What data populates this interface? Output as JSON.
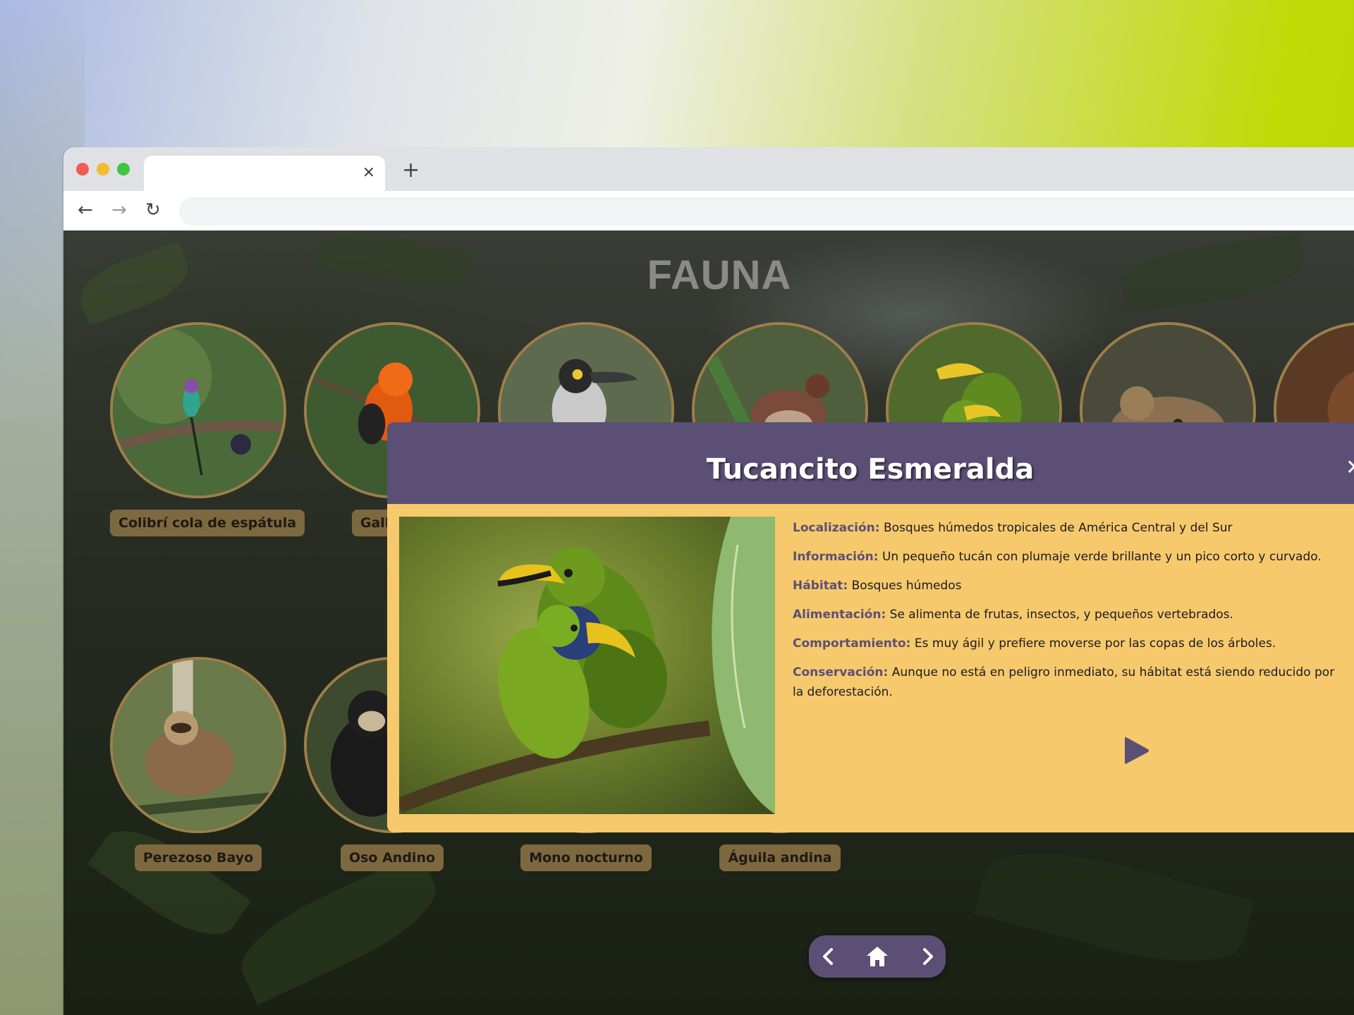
{
  "browser": {
    "tab_close": "×",
    "new_tab": "+",
    "back": "←",
    "forward": "→",
    "reload": "↻"
  },
  "page": {
    "title": "FAUNA"
  },
  "animals_top": [
    {
      "name": "Colibrí cola de espátula",
      "icon": "hummingbird"
    },
    {
      "name": "Gallito d",
      "icon": "cock-of-the-rock"
    },
    {
      "name": "",
      "icon": "toucan"
    },
    {
      "name": "",
      "icon": "thrush"
    },
    {
      "name": "",
      "icon": "emerald-toucanet"
    },
    {
      "name": "",
      "icon": "ocelot"
    },
    {
      "name": "",
      "icon": "animal"
    }
  ],
  "animals_bottom": [
    {
      "name": "Perezoso Bayo",
      "icon": "sloth"
    },
    {
      "name": "Oso Andino",
      "icon": "bear"
    },
    {
      "name": "Mono nocturno",
      "icon": "monkey"
    },
    {
      "name": "Águila andina",
      "icon": "eagle"
    }
  ],
  "modal": {
    "title": "Tucancito Esmeralda",
    "close": "✕",
    "fields": [
      {
        "label": "Localización:",
        "text": "Bosques húmedos tropicales de América Central y del Sur"
      },
      {
        "label": "Información:",
        "text": "Un pequeño tucán con plumaje verde brillante y un pico corto y curvado."
      },
      {
        "label": "Hábitat:",
        "text": "Bosques húmedos"
      },
      {
        "label": "Alimentación:",
        "text": "Se alimenta de frutas, insectos, y pequeños vertebrados."
      },
      {
        "label": "Comportamiento:",
        "text": "Es muy ágil y prefiere moverse por las copas de los árboles."
      },
      {
        "label": "Conservación:",
        "text": "Aunque no está en peligro inmediato, su hábitat está siendo reducido por la deforestación."
      }
    ]
  },
  "colors": {
    "modal_header": "#5c4f76",
    "modal_body": "#f6c96c",
    "label_bg": "#7d6840",
    "circle_border": "#9c7f4a"
  }
}
